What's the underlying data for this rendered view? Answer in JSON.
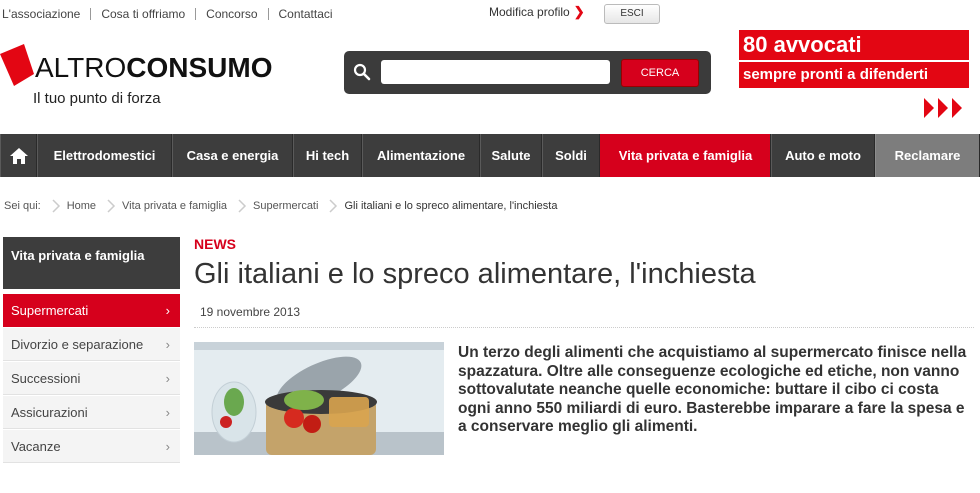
{
  "top_links": [
    "L'associazione",
    "Cosa ti offriamo",
    "Concorso",
    "Contattaci"
  ],
  "profile": {
    "label": "Modifica profilo",
    "logout": "ESCI"
  },
  "logo": {
    "part1": "ALTRO",
    "part2": "CONSUMO",
    "tagline": "Il tuo punto di forza"
  },
  "search": {
    "placeholder": "",
    "button": "CERCA"
  },
  "banner": {
    "line1": "80 avvocati",
    "line2": "sempre pronti a difenderti"
  },
  "nav": {
    "items": [
      "Elettrodomestici",
      "Casa e energia",
      "Hi tech",
      "Alimentazione",
      "Salute",
      "Soldi",
      "Vita privata e famiglia",
      "Auto e moto",
      "Reclamare"
    ],
    "active_index": 6
  },
  "breadcrumb": {
    "prefix": "Sei qui:",
    "items": [
      "Home",
      "Vita privata e famiglia",
      "Supermercati",
      "Gli italiani e lo spreco alimentare, l'inchiesta"
    ]
  },
  "sidebar": {
    "heading": "Vita privata e famiglia",
    "items": [
      "Supermercati",
      "Divorzio e separazione",
      "Successioni",
      "Assicurazioni",
      "Vacanze"
    ],
    "active_index": 0
  },
  "article": {
    "tag": "NEWS",
    "title": "Gli italiani e lo spreco alimentare, l'inchiesta",
    "date": "19 novembre 2013",
    "lead": "Un terzo degli alimenti che acquistiamo al supermercato finisce nella spazzatura. Oltre alle conseguenze ecologiche ed etiche, non vanno sottovalutate neanche quelle economiche: buttare il cibo ci costa ogni anno 550 miliardi di euro. Basterebbe imparare a fare la spesa e a conservare meglio gli alimenti."
  },
  "colors": {
    "accent": "#d6001c",
    "nav_bg": "#3d3d3d",
    "reclamare_bg": "#7d7d7d"
  }
}
